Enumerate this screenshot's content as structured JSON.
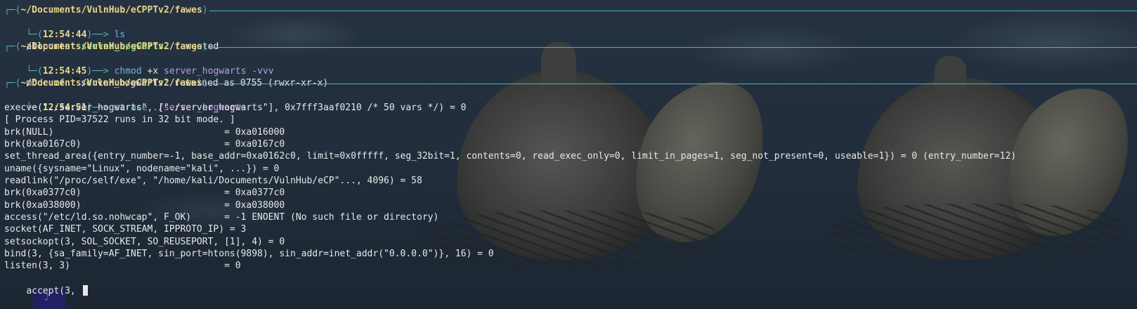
{
  "terminal": {
    "cwd": "~/Documents/VulnHub/eCPPTv2/fawes",
    "blocks": [
      {
        "time": "12:54:44",
        "command": "ls",
        "output": {
          "files": [
            "allports",
            "server_hogwarts",
            "targeted"
          ]
        }
      },
      {
        "time": "12:54:45",
        "command": "chmod",
        "args": [
          "+x",
          "server_hogwarts",
          "-vvv"
        ],
        "output": {
          "prefix": "mode of ",
          "rest": "server_hogwarts' retained as 0755 (rwxr-xr-x)"
        }
      },
      {
        "time": "12:54:51",
        "command": "strace",
        "args": [
          "./server_hogwarts"
        ],
        "output_lines": [
          "execve(\"./server_hogwarts\", [\"./server_hogwarts\"], 0x7fff3aaf0210 /* 50 vars */) = 0",
          "[ Process PID=37522 runs in 32 bit mode. ]",
          "brk(NULL)                               = 0xa016000",
          "brk(0xa0167c0)                          = 0xa0167c0",
          "set_thread_area({entry_number=-1, base_addr=0xa0162c0, limit=0x0fffff, seg_32bit=1, contents=0, read_exec_only=0, limit_in_pages=1, seg_not_present=0, useable=1}) = 0 (entry_number=12)",
          "uname({sysname=\"Linux\", nodename=\"kali\", ...}) = 0",
          "readlink(\"/proc/self/exe\", \"/home/kali/Documents/VulnHub/eCP\"..., 4096) = 58",
          "brk(0xa0377c0)                          = 0xa0377c0",
          "brk(0xa038000)                          = 0xa038000",
          "access(\"/etc/ld.so.nohwcap\", F_OK)      = -1 ENOENT (No such file or directory)",
          "socket(AF_INET, SOCK_STREAM, IPPROTO_IP) = 3",
          "setsockopt(3, SOL_SOCKET, SO_REUSEPORT, [1], 4) = 0",
          "bind(3, {sa_family=AF_INET, sin_port=htons(9898), sin_addr=inet_addr(\"0.0.0.0\")}, 16) = 0",
          "listen(3, 3)                            = 0"
        ],
        "pending_line": "accept(3, "
      }
    ]
  },
  "colors": {
    "accent": "#4fb3b8",
    "path": "#e8d68a",
    "command": "#6fb6e0",
    "argument": "#b79be6",
    "executable": "#7fd36a",
    "text": "#e8e8e8"
  },
  "icons": {
    "prompt_corner_top": "┌─(",
    "prompt_corner_bottom": "└─(",
    "prompt_arrow": ")──> "
  }
}
